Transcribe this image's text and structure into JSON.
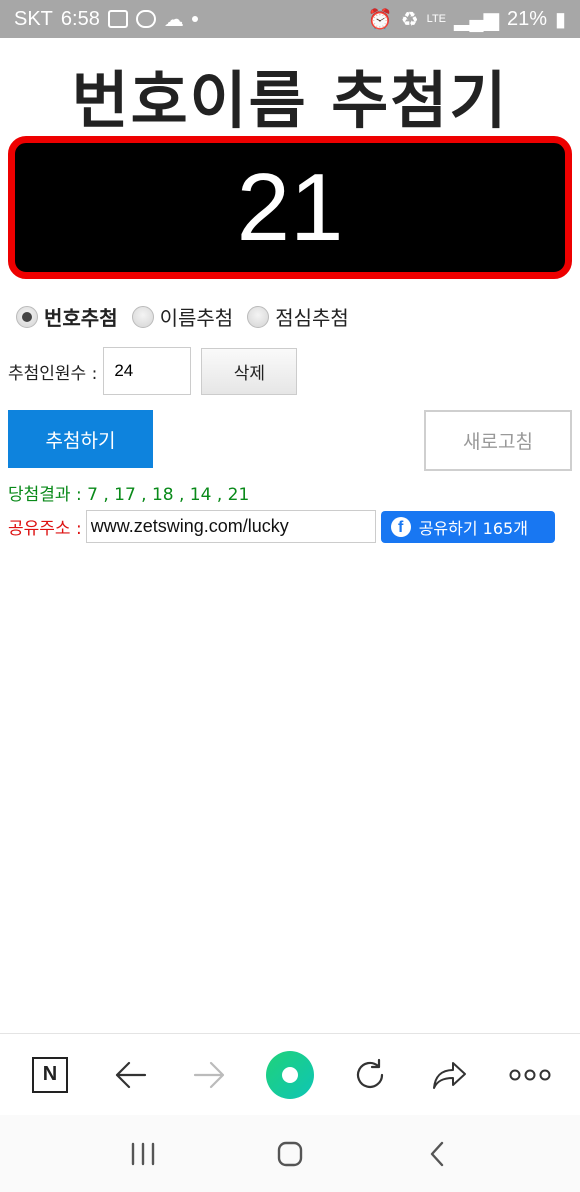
{
  "status_bar": {
    "carrier": "SKT",
    "time": "6:58",
    "network": "LTE",
    "battery": "21%"
  },
  "app": {
    "title": "번호이름 추첨기",
    "display_number": "21"
  },
  "mode_options": [
    {
      "label": "번호추첨",
      "checked": true
    },
    {
      "label": "이름추첨",
      "checked": false
    },
    {
      "label": "점심추첨",
      "checked": false
    }
  ],
  "count": {
    "label": "추첨인원수 :",
    "value": "24",
    "delete_label": "삭제"
  },
  "actions": {
    "draw_label": "추첨하기",
    "refresh_label": "새로고침"
  },
  "result": {
    "text": "당첨결과 : 7 , 17 , 18 , 14 , 21"
  },
  "share": {
    "label": "공유주소 :",
    "url": "www.zetswing.com/lucky",
    "fb_label": "공유하기 165개"
  },
  "colors": {
    "accent_blue": "#0e83dd",
    "display_border": "#ee0000",
    "result_green": "#0a8a1a",
    "share_red": "#dd1111",
    "facebook_blue": "#1877f2"
  },
  "icons": {
    "browser_bar": [
      "naver-n-icon",
      "back-arrow-icon",
      "forward-arrow-icon",
      "home-green-circle-icon",
      "reload-icon",
      "share-arrow-icon",
      "more-dots-icon"
    ],
    "nav_bar": [
      "recent-apps-icon",
      "home-icon",
      "back-icon"
    ]
  }
}
